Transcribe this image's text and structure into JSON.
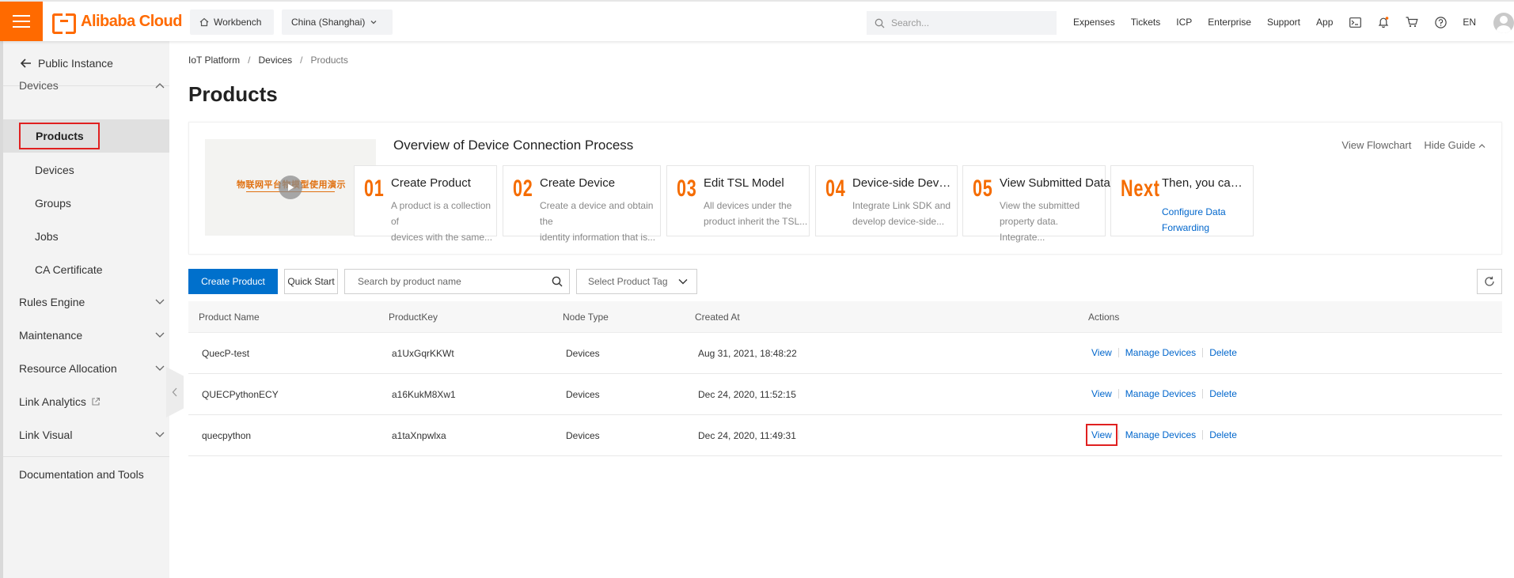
{
  "topbar": {
    "brand": "Alibaba Cloud",
    "workbench": "Workbench",
    "region": "China (Shanghai)",
    "search_placeholder": "Search...",
    "nav": [
      "Expenses",
      "Tickets",
      "ICP",
      "Enterprise",
      "Support",
      "App"
    ],
    "lang": "EN",
    "icons": [
      "terminal-icon",
      "bell-icon",
      "cart-icon",
      "help-icon"
    ],
    "accent": "#ff6a00"
  },
  "sidebar": {
    "back": "Public Instance",
    "devices_group": "Devices",
    "active_item": "Products",
    "sub_items": [
      "Devices",
      "Groups",
      "Jobs",
      "CA Certificate"
    ],
    "groups": [
      "Rules Engine",
      "Maintenance",
      "Resource Allocation",
      "Link Analytics",
      "Link Visual"
    ],
    "docs": "Documentation and Tools"
  },
  "breadcrumb": [
    "IoT Platform",
    "Devices",
    "Products"
  ],
  "page_title": "Products",
  "guide": {
    "video_text": "物联网平台物模型使用演示",
    "title": "Overview of Device Connection Process",
    "view_flowchart": "View Flowchart",
    "hide_guide": "Hide Guide",
    "steps": [
      {
        "num": "01",
        "title": "Create Product",
        "desc1": "A product is a collection of",
        "desc2": "devices with the same..."
      },
      {
        "num": "02",
        "title": "Create Device",
        "desc1": "Create a device and obtain the",
        "desc2": "identity information that is..."
      },
      {
        "num": "03",
        "title": "Edit TSL Model",
        "desc1": "All devices under the",
        "desc2": "product inherit the TSL..."
      },
      {
        "num": "04",
        "title": "Device-side Develop...",
        "desc1": "Integrate Link SDK and",
        "desc2": "develop device-side..."
      },
      {
        "num": "05",
        "title": "View Submitted Data",
        "desc1": "View the submitted",
        "desc2": "property data. Integrate..."
      },
      {
        "num": "Next",
        "title": "Then, you can perf...",
        "link1": "Configure Data",
        "link2": "Forwarding"
      }
    ]
  },
  "toolbar": {
    "create": "Create Product",
    "quick_start": "Quick Start",
    "search_placeholder": "Search by product name",
    "tag_select": "Select Product Tag"
  },
  "table": {
    "headers": [
      "Product Name",
      "ProductKey",
      "Node Type",
      "Created At",
      "Actions"
    ],
    "rows": [
      {
        "name": "QuecP-test",
        "key": "a1UxGqrKKWt",
        "node": "Devices",
        "created": "Aug 31, 2021, 18:48:22"
      },
      {
        "name": "QUECPythonECY",
        "key": "a16KukM8Xw1",
        "node": "Devices",
        "created": "Dec 24, 2020, 11:52:15"
      },
      {
        "name": "quecpython",
        "key": "a1taXnpwlxa",
        "node": "Devices",
        "created": "Dec 24, 2020, 11:49:31"
      }
    ],
    "actions": [
      "View",
      "Manage Devices",
      "Delete"
    ]
  }
}
